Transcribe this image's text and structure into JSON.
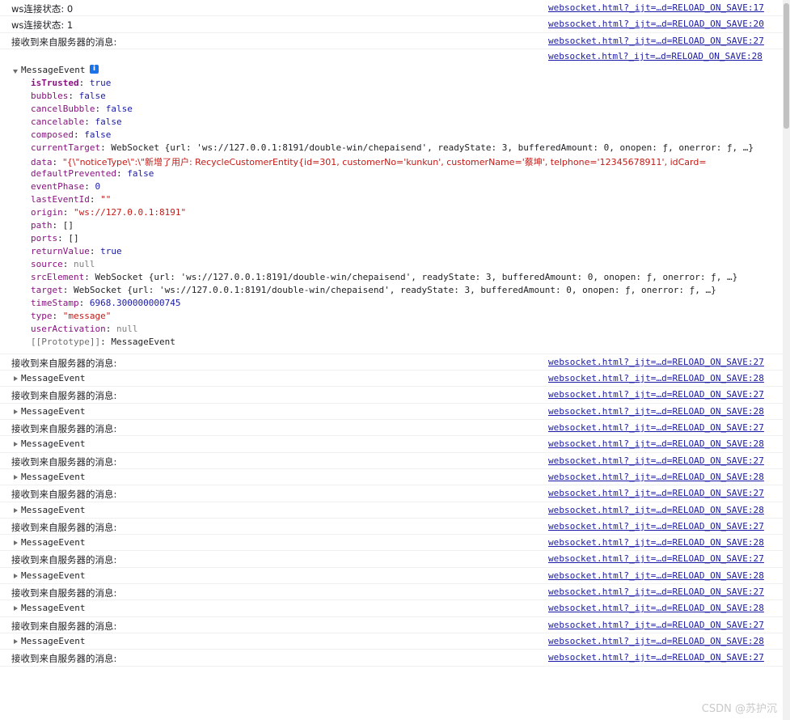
{
  "source_17": "websocket.html?_ijt=…d=RELOAD_ON_SAVE:17",
  "source_20": "websocket.html?_ijt=…d=RELOAD_ON_SAVE:20",
  "source_27": "websocket.html?_ijt=…d=RELOAD_ON_SAVE:27",
  "source_28": "websocket.html?_ijt=…d=RELOAD_ON_SAVE:28",
  "log_ws_0": "ws连接状态: 0",
  "log_ws_1": "ws连接状态: 1",
  "log_received": "接收到来自服务器的消息:",
  "message_event": "MessageEvent",
  "info_glyph": "i",
  "props": {
    "isTrusted": {
      "key": "isTrusted",
      "value": "true"
    },
    "bubbles": {
      "key": "bubbles",
      "value": "false"
    },
    "cancelBubble": {
      "key": "cancelBubble",
      "value": "false"
    },
    "cancelable": {
      "key": "cancelable",
      "value": "false"
    },
    "composed": {
      "key": "composed",
      "value": "false"
    },
    "currentTarget": {
      "key": "currentTarget",
      "value": "WebSocket {url: 'ws://127.0.0.1:8191/double-win/chepaisend', readyState: 3, bufferedAmount: 0, onopen: ƒ, onerror: ƒ, …}"
    },
    "data": {
      "key": "data",
      "value": "\"{\\\"noticeType\\\":\\\"新增了用户: RecycleCustomerEntity{id=301, customerNo='kunkun', customerName='蔡坤', telphone='12345678911', idCard="
    },
    "defaultPrevented": {
      "key": "defaultPrevented",
      "value": "false"
    },
    "eventPhase": {
      "key": "eventPhase",
      "value": "0"
    },
    "lastEventId": {
      "key": "lastEventId",
      "value": "\"\""
    },
    "origin": {
      "key": "origin",
      "value": "\"ws://127.0.0.1:8191\""
    },
    "path": {
      "key": "path",
      "value": "[]"
    },
    "ports": {
      "key": "ports",
      "value": "[]"
    },
    "returnValue": {
      "key": "returnValue",
      "value": "true"
    },
    "source": {
      "key": "source",
      "value": "null"
    },
    "srcElement": {
      "key": "srcElement",
      "value": "WebSocket {url: 'ws://127.0.0.1:8191/double-win/chepaisend', readyState: 3, bufferedAmount: 0, onopen: ƒ, onerror: ƒ, …}"
    },
    "target": {
      "key": "target",
      "value": "WebSocket {url: 'ws://127.0.0.1:8191/double-win/chepaisend', readyState: 3, bufferedAmount: 0, onopen: ƒ, onerror: ƒ, …}"
    },
    "timeStamp": {
      "key": "timeStamp",
      "value": "6968.300000000745"
    },
    "type": {
      "key": "type",
      "value": "\"message\""
    },
    "userActivation": {
      "key": "userActivation",
      "value": "null"
    },
    "prototype": {
      "key": "[[Prototype]]",
      "value": "MessageEvent"
    }
  },
  "watermark": "CSDN @苏护沉"
}
